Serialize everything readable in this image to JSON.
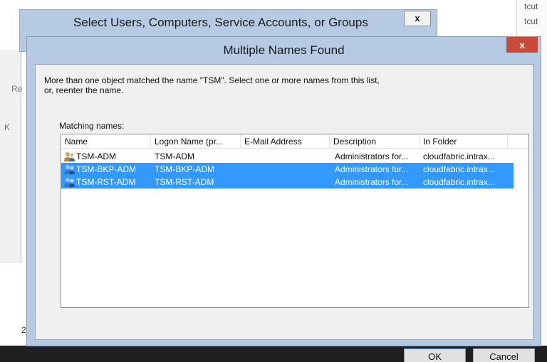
{
  "background": {
    "right_texts": [
      "tcut",
      "tcut"
    ],
    "left_labels": [
      "Re",
      "K"
    ],
    "left_bottom_text": "2"
  },
  "back_window": {
    "title": "Select Users, Computers, Service Accounts, or Groups",
    "close_label": "x"
  },
  "dialog": {
    "title": "Multiple Names Found",
    "close_label": "x",
    "message": "More than one object matched the name \"TSM\". Select one or more names from this list, or, reenter the name.",
    "matching_label": "Matching names:",
    "columns": [
      "Name",
      "Logon Name (pr...",
      "E-Mail Address",
      "Description",
      "In Folder"
    ],
    "rows": [
      {
        "name": "TSM-ADM",
        "logon": "TSM-ADM",
        "email": "",
        "description": "Administrators for...",
        "folder": "cloudfabric.intrax...",
        "selected": false
      },
      {
        "name": "TSM-BKP-ADM",
        "logon": "TSM-BKP-ADM",
        "email": "",
        "description": "Administrators for...",
        "folder": "cloudfabric.intrax...",
        "selected": true
      },
      {
        "name": "TSM-RST-ADM",
        "logon": "TSM-RST-ADM",
        "email": "",
        "description": "Administrators for...",
        "folder": "cloudfabric.intrax...",
        "selected": true
      }
    ],
    "ok_label": "OK",
    "cancel_label": "Cancel",
    "row_icon": "group-users-icon"
  },
  "colors": {
    "title_bar": "#b6cbe3",
    "selection": "#3399ff",
    "close_red": "#c74b38"
  }
}
